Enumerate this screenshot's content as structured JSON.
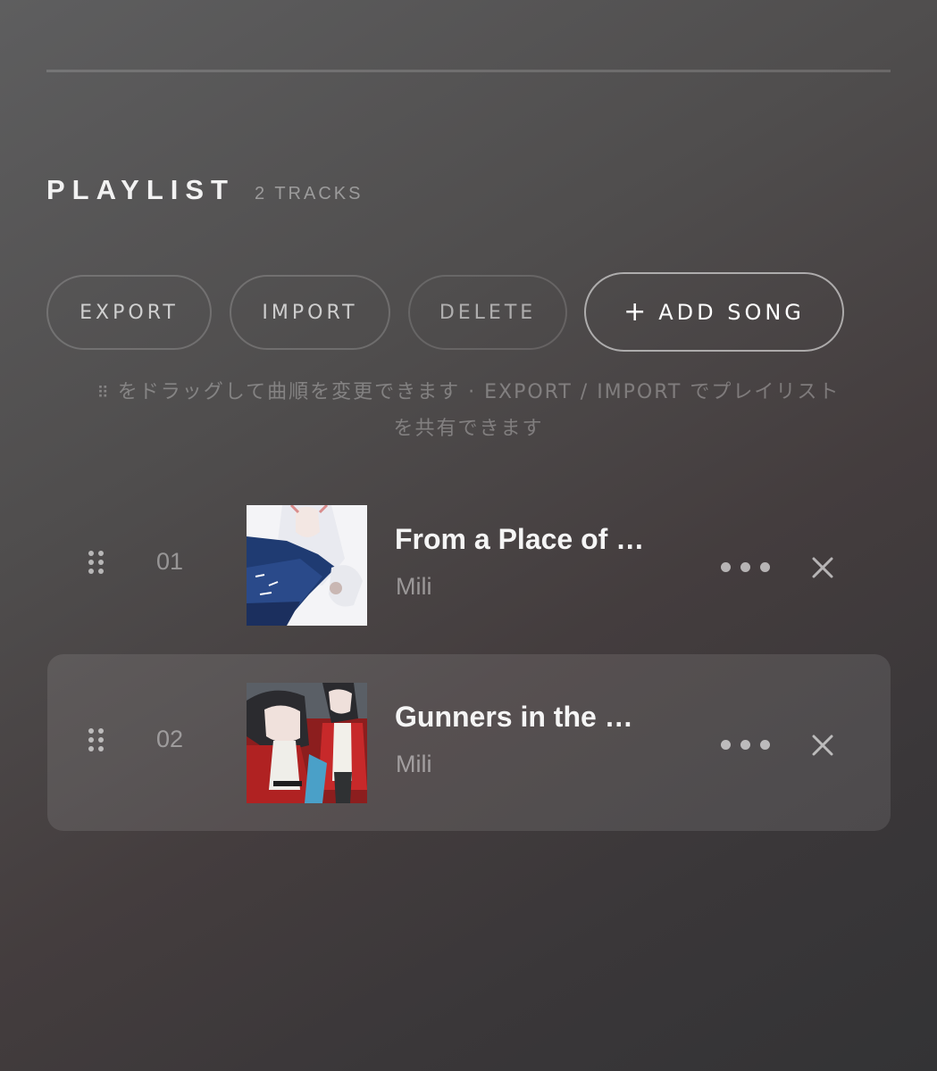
{
  "playlist": {
    "title": "PLAYLIST",
    "count_label": "2 TRACKS"
  },
  "toolbar": {
    "export_label": "EXPORT",
    "import_label": "IMPORT",
    "delete_label": "DELETE",
    "add_icon": "+",
    "add_label": "ADD SONG"
  },
  "hint": {
    "grip_icon": "⠿",
    "line1": "をドラッグして曲順を変更できます · EXPORT / IMPORT でプレイリスト",
    "line2": "を共有できます"
  },
  "tracks": [
    {
      "number": "01",
      "title": "From a Place of …",
      "artist": "Mili"
    },
    {
      "number": "02",
      "title": "Gunners in the …",
      "artist": "Mili"
    }
  ],
  "icons": {
    "drag": "drag-handle-icon",
    "more": "more-horizontal-icon",
    "remove": "close-icon"
  },
  "colors": {
    "accent": "#ffffff",
    "muted_text": "#8a8a8a",
    "selected_row": "#5d5e60"
  }
}
